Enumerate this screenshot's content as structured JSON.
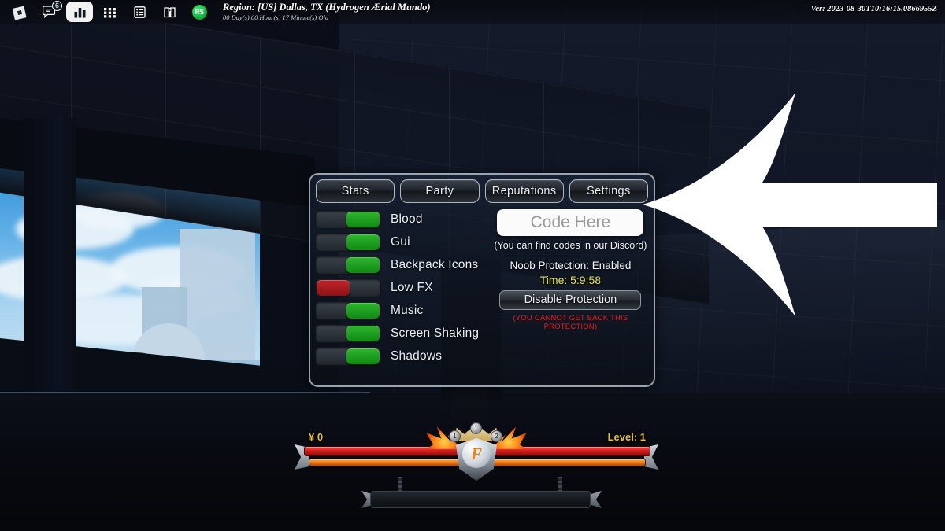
{
  "topbar": {
    "icons": [
      {
        "name": "roblox-logo-icon",
        "label": "Roblox"
      },
      {
        "name": "chat-icon",
        "label": "Chat",
        "badge": "6"
      },
      {
        "name": "leaderboard-icon",
        "label": "Leaderboard",
        "active": true
      },
      {
        "name": "grid-menu-icon",
        "label": "Menu"
      },
      {
        "name": "list-icon",
        "label": "List"
      },
      {
        "name": "guidebook-icon",
        "label": "Guide"
      },
      {
        "name": "robux-icon",
        "label": "R$"
      }
    ],
    "region_line1": "Region: [US] Dallas, TX (Hydrogen Ærial Mundo)",
    "region_line2": "00 Day(s) 00 Hour(s) 17 Minute(s) Old",
    "version": "Ver: 2023-08-30T10:16:15.0866955Z"
  },
  "panel": {
    "tabs": [
      {
        "label": "Stats",
        "selected": false
      },
      {
        "label": "Party",
        "selected": false
      },
      {
        "label": "Reputations",
        "selected": false
      },
      {
        "label": "Settings",
        "selected": true
      }
    ],
    "toggles": [
      {
        "label": "Blood",
        "state": "on"
      },
      {
        "label": "Gui",
        "state": "on"
      },
      {
        "label": "Backpack Icons",
        "state": "on"
      },
      {
        "label": "Low FX",
        "state": "off"
      },
      {
        "label": "Music",
        "state": "on"
      },
      {
        "label": "Screen Shaking",
        "state": "on"
      },
      {
        "label": "Shadows",
        "state": "on"
      }
    ],
    "code": {
      "placeholder": "Code Here",
      "value": "",
      "hint": "(You can find codes in our Discord)"
    },
    "protection": {
      "status": "Noob Protection: Enabled",
      "timer": "Time: 5:9:58",
      "button_label": "Disable Protection",
      "warning": "(YOU CANNOT GET BACK THIS PROTECTION)",
      "timer_color": "#e7e431",
      "warning_color": "#f21717"
    }
  },
  "hud": {
    "money": "¥ 0",
    "level": "Level: 1",
    "emblem_letter": "F",
    "emblem_gems": [
      "1",
      "1",
      "2"
    ],
    "health_color": "#d01b1b",
    "xp_color": "#f2720c",
    "accent_gold": "#e9c22a"
  },
  "annotation": {
    "arrow_name": "pointer-arrow",
    "arrow_color": "#ffffff",
    "points_at": "Code Here"
  }
}
